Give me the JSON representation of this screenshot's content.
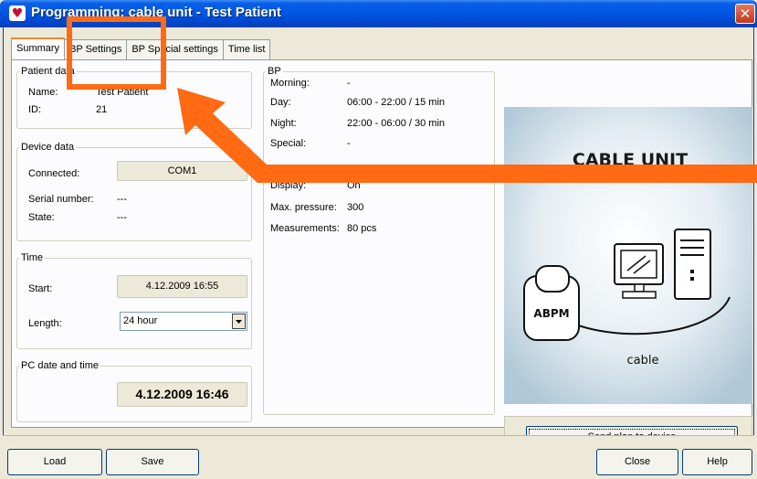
{
  "window": {
    "title": "Programming: cable unit - Test Patient",
    "close_glyph": "✕",
    "icon": "heart-icon"
  },
  "tabs": [
    {
      "label": "Summary",
      "active": true
    },
    {
      "label": "BP Settings",
      "active": false
    },
    {
      "label": "BP Special settings",
      "active": false
    },
    {
      "label": "Time list",
      "active": false
    }
  ],
  "patient": {
    "legend": "Patient data",
    "name_label": "Name:",
    "name_value": "Test Patient",
    "id_label": "ID:",
    "id_value": "21"
  },
  "device": {
    "legend": "Device data",
    "connected_label": "Connected:",
    "connected_value": "COM1",
    "serial_label": "Serial number:",
    "serial_value": "---",
    "state_label": "State:",
    "state_value": "---"
  },
  "time": {
    "legend": "Time",
    "start_label": "Start:",
    "start_value": "4.12.2009 16:55",
    "length_label": "Length:",
    "length_value": "24 hour"
  },
  "pc_time": {
    "legend": "PC date and time",
    "value": "4.12.2009 16:46"
  },
  "bp": {
    "legend": "BP",
    "morning_label": "Morning:",
    "morning_value": "-",
    "day_label": "Day:",
    "day_value": "06:00 - 22:00 / 15 min",
    "night_label": "Night:",
    "night_value": "22:00 - 06:00 / 30 min",
    "special_label": "Special:",
    "special_value": "-",
    "display_label": "Display:",
    "display_value": "On",
    "max_pressure_label": "Max. pressure:",
    "max_pressure_value": "300",
    "measurements_label": "Measurements:",
    "measurements_value": "80 pcs"
  },
  "illustration": {
    "title": "CABLE UNIT",
    "device_label": "ABPM",
    "cable_label": "cable"
  },
  "buttons": {
    "send_plan": "Send plan to device",
    "load": "Load",
    "save": "Save",
    "close": "Close",
    "help": "Help"
  },
  "annotation": {
    "color": "#ff6a13"
  }
}
